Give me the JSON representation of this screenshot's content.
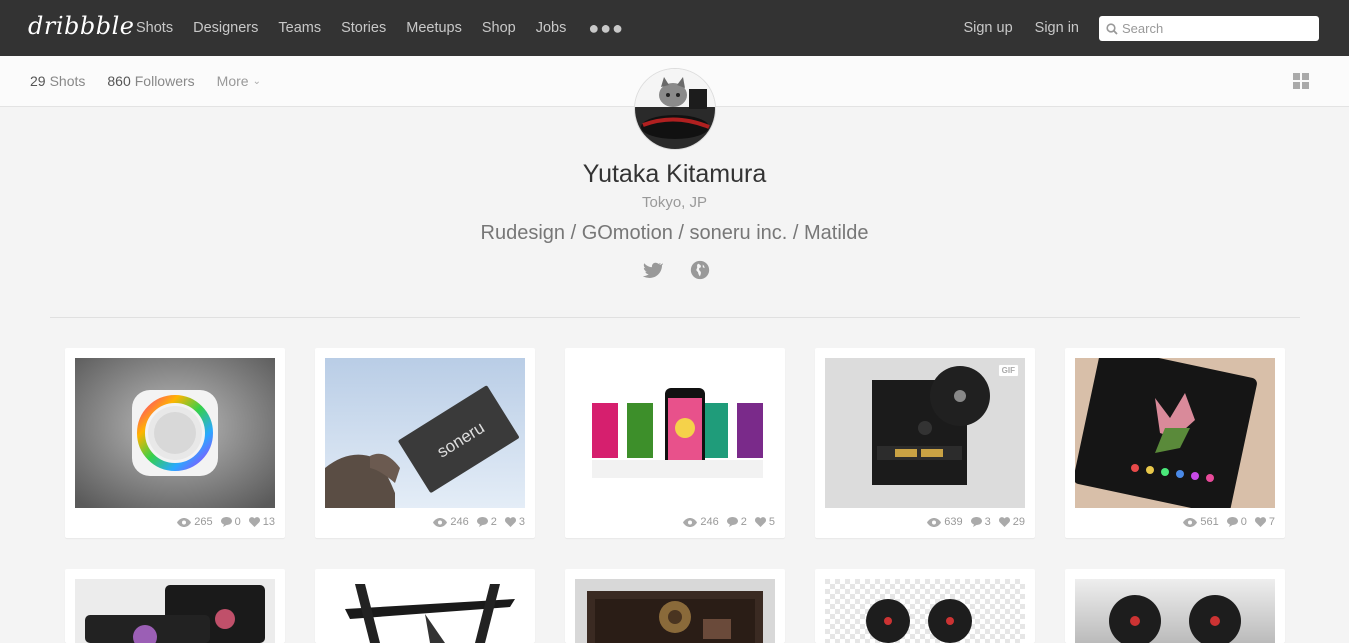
{
  "nav": {
    "logo": "dribbble",
    "links": [
      "Shots",
      "Designers",
      "Teams",
      "Stories",
      "Meetups",
      "Shop",
      "Jobs"
    ],
    "more_icon": "ellipsis-icon",
    "sign_up": "Sign up",
    "sign_in": "Sign in",
    "search_placeholder": "Search"
  },
  "subbar": {
    "shots_count": "29",
    "shots_label": "Shots",
    "followers_count": "860",
    "followers_label": "Followers",
    "more_label": "More"
  },
  "profile": {
    "name": "Yutaka Kitamura",
    "location": "Tokyo, JP",
    "bio": "Rudesign / GOmotion / soneru inc. / Matilde",
    "social_icons": [
      "twitter-icon",
      "globe-icon"
    ]
  },
  "colors": {
    "topbar": "#333333",
    "background": "#f4f4f4"
  },
  "shots": [
    {
      "views": "265",
      "comments": "0",
      "likes": "13",
      "gif": false
    },
    {
      "views": "246",
      "comments": "2",
      "likes": "3",
      "gif": false
    },
    {
      "views": "246",
      "comments": "2",
      "likes": "5",
      "gif": false
    },
    {
      "views": "639",
      "comments": "3",
      "likes": "29",
      "gif": true
    },
    {
      "views": "561",
      "comments": "0",
      "likes": "7",
      "gif": false
    }
  ],
  "gif_label": "GIF"
}
